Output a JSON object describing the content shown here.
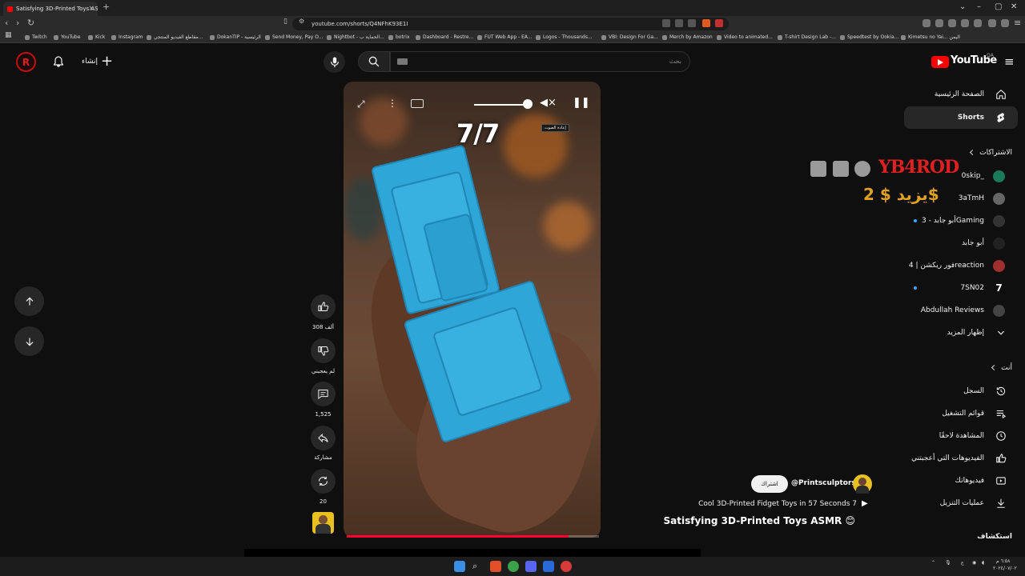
{
  "browser": {
    "tab_title": "Satisfying 3D-Printed Toys ASMR",
    "url": "youtube.com/shorts/Q4NFhK93E1I",
    "bookmarks": [
      "Twitch",
      "YouTube",
      "Kick",
      "Instagram",
      "مقاطع الفيديو المنتجي...",
      "DokanTIP - الرئيسية",
      "Send Money, Pay O...",
      "Nightbot - الحماية ب...",
      "botrix",
      "Dashboard - Restre...",
      "FUT Web App - EA...",
      "Logos - Thousands...",
      "VBI: Design For Ga...",
      "Merch by Amazon",
      "Video to animated...",
      "T-shirt Design Lab -...",
      "Speedtest by Ookia...",
      "Kimetsu no Yai... اليمن"
    ]
  },
  "header": {
    "logo": "YouTube",
    "country": "QA",
    "search_placeholder": "بحث",
    "create_label": "إنشاء"
  },
  "video": {
    "counter": "7/7",
    "tooltip": "إعادة الصوت",
    "volume": 0.9,
    "progress": 0.88
  },
  "actions": {
    "likes": "308 ألف",
    "dislike": "لم يعجبني",
    "comments": "1,525",
    "share": "مشاركة",
    "remix": "20"
  },
  "channel": {
    "subscribe": "اشتراك",
    "handle": "@Printsculptors",
    "subtitle": "Cool 3D-Printed Fidget Toys in 57 Seconds 7",
    "title": "Satisfying 3D-Printed Toys ASMR 😊"
  },
  "sidebar": {
    "home": "الصفحة الرئيسية",
    "shorts": "Shorts",
    "subscriptions": "الاشتراكات",
    "subs": [
      "0skip_",
      "3aTmH",
      "أبو جابد - 3Gaming",
      "أبو جابد",
      "فور ريكشن | 4reaction",
      "7SN02",
      "Abdullah Reviews"
    ],
    "show_more": "إظهار المزيد",
    "you": "أنت",
    "history": "السجل",
    "playlists": "قوائم التشغيل",
    "watch_later": "المشاهدة لاحقًا",
    "liked": "الفيديوهات التي أعجبتني",
    "your_videos": "فيديوهاتك",
    "downloads": "عمليات التنزيل",
    "explore": "استكشاف"
  },
  "overlay": {
    "brand": "YB4ROD",
    "money": "يزيد $ 2$"
  },
  "taskbar": {
    "lang": "ع",
    "time": "٦:٥٨ م",
    "date": "٢٠٢٤/٠٧/٠٢"
  }
}
